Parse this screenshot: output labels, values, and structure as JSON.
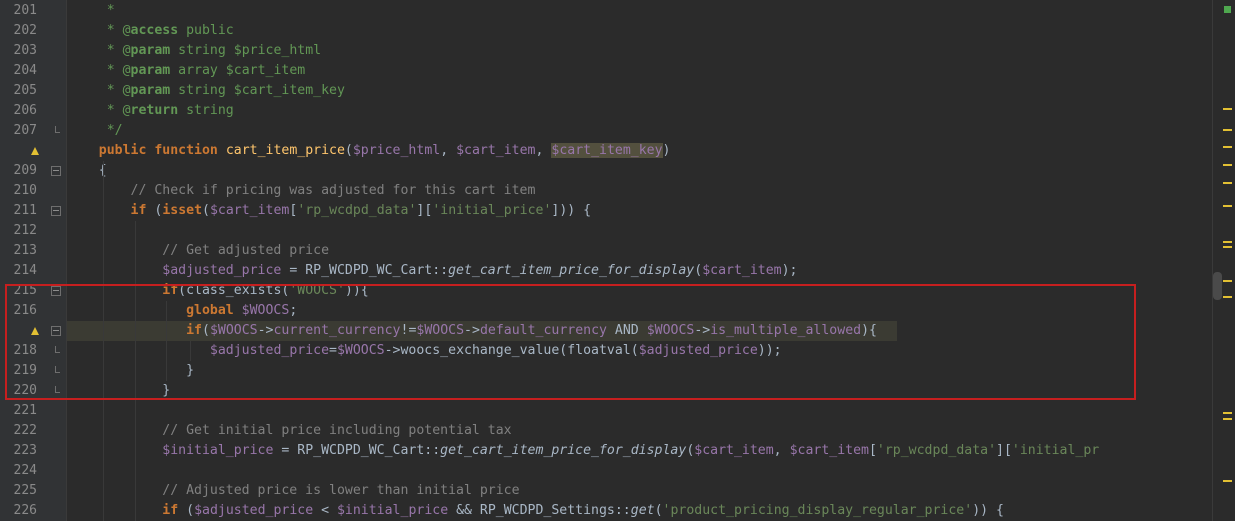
{
  "editor": {
    "theme": "Darcula",
    "language": "PHP"
  },
  "colors": {
    "selection_box": "#c61f1f",
    "warning": "#e2c033",
    "ok": "#4fa84f",
    "keyword": "#cc7832",
    "string": "#6a8759",
    "variable": "#9876aa"
  },
  "lines": [
    {
      "num": "201",
      "parts": [
        {
          "t": "     *",
          "c": "doc"
        }
      ]
    },
    {
      "num": "202",
      "parts": [
        {
          "t": "     * @",
          "c": "doc"
        },
        {
          "t": "access",
          "c": "dt"
        },
        {
          "t": " public",
          "c": "doc"
        }
      ]
    },
    {
      "num": "203",
      "parts": [
        {
          "t": "     * @",
          "c": "doc"
        },
        {
          "t": "param",
          "c": "dt"
        },
        {
          "t": " string $price_html",
          "c": "doc"
        }
      ]
    },
    {
      "num": "204",
      "parts": [
        {
          "t": "     * @",
          "c": "doc"
        },
        {
          "t": "param",
          "c": "dt"
        },
        {
          "t": " array $cart_item",
          "c": "doc"
        }
      ]
    },
    {
      "num": "205",
      "parts": [
        {
          "t": "     * @",
          "c": "doc"
        },
        {
          "t": "param",
          "c": "dt"
        },
        {
          "t": " string $cart_item_key",
          "c": "doc"
        }
      ]
    },
    {
      "num": "206",
      "parts": [
        {
          "t": "     * @",
          "c": "doc"
        },
        {
          "t": "return",
          "c": "dt"
        },
        {
          "t": " string",
          "c": "doc"
        }
      ]
    },
    {
      "num": "207",
      "parts": [
        {
          "t": "     */",
          "c": "doc"
        }
      ]
    },
    {
      "num": "",
      "warn": true,
      "parts": [
        {
          "t": "    ",
          "c": ""
        },
        {
          "t": "public function ",
          "c": "kw"
        },
        {
          "t": "cart_item_price",
          "c": "fn"
        },
        {
          "t": "(",
          "c": ""
        },
        {
          "t": "$price_html",
          "c": "var"
        },
        {
          "t": ", ",
          "c": ""
        },
        {
          "t": "$cart_item",
          "c": "var"
        },
        {
          "t": ", ",
          "c": ""
        },
        {
          "t": "$cart_item_key",
          "c": "var hv"
        },
        {
          "t": ")",
          "c": ""
        }
      ]
    },
    {
      "num": "209",
      "parts": [
        {
          "t": "    {",
          "c": ""
        }
      ]
    },
    {
      "num": "210",
      "parts": [
        {
          "t": "        // Check if pricing was adjusted for this cart item",
          "c": "cm"
        }
      ]
    },
    {
      "num": "211",
      "parts": [
        {
          "t": "        ",
          "c": ""
        },
        {
          "t": "if",
          "c": "kw"
        },
        {
          "t": " (",
          "c": ""
        },
        {
          "t": "isset",
          "c": "kw"
        },
        {
          "t": "(",
          "c": ""
        },
        {
          "t": "$cart_item",
          "c": "var"
        },
        {
          "t": "[",
          "c": ""
        },
        {
          "t": "'rp_wcdpd_data'",
          "c": "str"
        },
        {
          "t": "][",
          "c": ""
        },
        {
          "t": "'initial_price'",
          "c": "str"
        },
        {
          "t": "])) {",
          "c": ""
        }
      ]
    },
    {
      "num": "212",
      "parts": []
    },
    {
      "num": "213",
      "parts": [
        {
          "t": "            // Get adjusted price",
          "c": "cm"
        }
      ]
    },
    {
      "num": "214",
      "parts": [
        {
          "t": "            ",
          "c": ""
        },
        {
          "t": "$adjusted_price",
          "c": "var"
        },
        {
          "t": " = RP_WCDPD_WC_Cart::",
          "c": ""
        },
        {
          "t": "get_cart_item_price_for_display",
          "c": "it"
        },
        {
          "t": "(",
          "c": ""
        },
        {
          "t": "$cart_item",
          "c": "var"
        },
        {
          "t": ");",
          "c": ""
        }
      ]
    },
    {
      "num": "215",
      "parts": [
        {
          "t": "            ",
          "c": ""
        },
        {
          "t": "if",
          "c": "kw"
        },
        {
          "t": "(class_exists(",
          "c": ""
        },
        {
          "t": "'WOOCS'",
          "c": "str"
        },
        {
          "t": ")){",
          "c": ""
        }
      ]
    },
    {
      "num": "216",
      "parts": [
        {
          "t": "               ",
          "c": ""
        },
        {
          "t": "global ",
          "c": "kw"
        },
        {
          "t": "$WOOCS",
          "c": "var"
        },
        {
          "t": ";",
          "c": ""
        }
      ]
    },
    {
      "num": "",
      "warn": true,
      "hl": true,
      "parts": [
        {
          "t": "               ",
          "c": ""
        },
        {
          "t": "if",
          "c": "kw"
        },
        {
          "t": "(",
          "c": ""
        },
        {
          "t": "$WOOCS",
          "c": "var"
        },
        {
          "t": "->",
          "c": ""
        },
        {
          "t": "current_currency",
          "c": "var"
        },
        {
          "t": "!=",
          "c": ""
        },
        {
          "t": "$WOOCS",
          "c": "var"
        },
        {
          "t": "->",
          "c": ""
        },
        {
          "t": "default_currency",
          "c": "var"
        },
        {
          "t": " AND ",
          "c": ""
        },
        {
          "t": "$WOOCS",
          "c": "var"
        },
        {
          "t": "->",
          "c": ""
        },
        {
          "t": "is_multiple_allowed",
          "c": "var"
        },
        {
          "t": "){",
          "c": ""
        }
      ]
    },
    {
      "num": "218",
      "parts": [
        {
          "t": "                  ",
          "c": ""
        },
        {
          "t": "$adjusted_price",
          "c": "var"
        },
        {
          "t": "=",
          "c": ""
        },
        {
          "t": "$WOOCS",
          "c": "var"
        },
        {
          "t": "->woocs_exchange_value(floatval(",
          "c": ""
        },
        {
          "t": "$adjusted_price",
          "c": "var"
        },
        {
          "t": "));",
          "c": ""
        }
      ]
    },
    {
      "num": "219",
      "parts": [
        {
          "t": "               }",
          "c": ""
        }
      ]
    },
    {
      "num": "220",
      "parts": [
        {
          "t": "            }",
          "c": ""
        }
      ]
    },
    {
      "num": "221",
      "parts": []
    },
    {
      "num": "222",
      "parts": [
        {
          "t": "            // Get initial price including potential tax",
          "c": "cm"
        }
      ]
    },
    {
      "num": "223",
      "parts": [
        {
          "t": "            ",
          "c": ""
        },
        {
          "t": "$initial_price",
          "c": "var"
        },
        {
          "t": " = RP_WCDPD_WC_Cart::",
          "c": ""
        },
        {
          "t": "get_cart_item_price_for_display",
          "c": "it"
        },
        {
          "t": "(",
          "c": ""
        },
        {
          "t": "$cart_item",
          "c": "var"
        },
        {
          "t": ", ",
          "c": ""
        },
        {
          "t": "$cart_item",
          "c": "var"
        },
        {
          "t": "[",
          "c": ""
        },
        {
          "t": "'rp_wcdpd_data'",
          "c": "str"
        },
        {
          "t": "][",
          "c": ""
        },
        {
          "t": "'initial_pr",
          "c": "str"
        }
      ]
    },
    {
      "num": "224",
      "parts": []
    },
    {
      "num": "225",
      "parts": [
        {
          "t": "            // Adjusted price is lower than initial price",
          "c": "cm"
        }
      ]
    },
    {
      "num": "226",
      "parts": [
        {
          "t": "            ",
          "c": ""
        },
        {
          "t": "if",
          "c": "kw"
        },
        {
          "t": " (",
          "c": ""
        },
        {
          "t": "$adjusted_price",
          "c": "var"
        },
        {
          "t": " < ",
          "c": ""
        },
        {
          "t": "$initial_price",
          "c": "var"
        },
        {
          "t": " && RP_WCDPD_Settings::",
          "c": ""
        },
        {
          "t": "get",
          "c": "it"
        },
        {
          "t": "(",
          "c": ""
        },
        {
          "t": "'product_pricing_display_regular_price'",
          "c": "str"
        },
        {
          "t": ")) {",
          "c": ""
        }
      ]
    }
  ]
}
